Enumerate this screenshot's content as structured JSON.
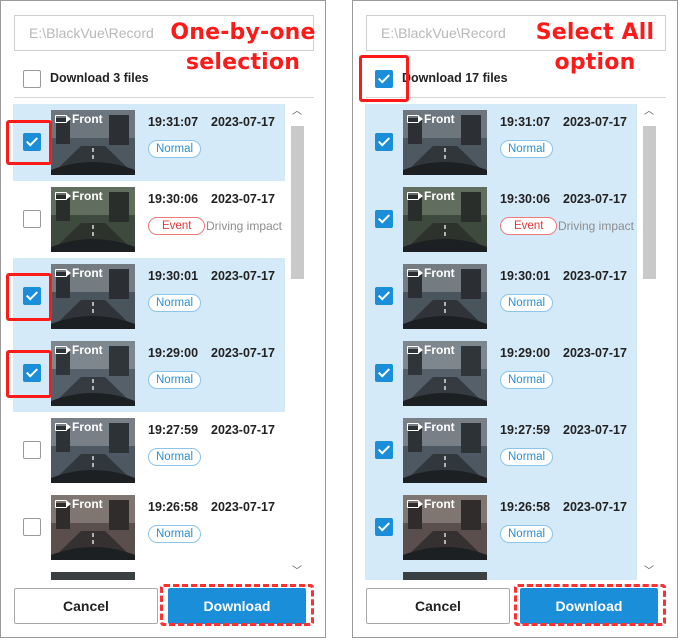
{
  "panels": [
    {
      "path_placeholder": "E:\\BlackVue\\Record",
      "callout": [
        "One-by-one",
        "selection"
      ],
      "select_all_checked": false,
      "download_count_text": "Download 3 files",
      "rows": [
        {
          "camera": "Front",
          "time": "19:31:07",
          "date": "2023-07-17",
          "badge": "Normal",
          "badge_type": "normal",
          "description": "",
          "checked": true
        },
        {
          "camera": "Front",
          "time": "19:30:06",
          "date": "2023-07-17",
          "badge": "Event",
          "badge_type": "event",
          "description": "Driving impact",
          "checked": false
        },
        {
          "camera": "Front",
          "time": "19:30:01",
          "date": "2023-07-17",
          "badge": "Normal",
          "badge_type": "normal",
          "description": "",
          "checked": true
        },
        {
          "camera": "Front",
          "time": "19:29:00",
          "date": "2023-07-17",
          "badge": "Normal",
          "badge_type": "normal",
          "description": "",
          "checked": true
        },
        {
          "camera": "Front",
          "time": "19:27:59",
          "date": "2023-07-17",
          "badge": "Normal",
          "badge_type": "normal",
          "description": "",
          "checked": false
        },
        {
          "camera": "Front",
          "time": "19:26:58",
          "date": "2023-07-17",
          "badge": "Normal",
          "badge_type": "normal",
          "description": "",
          "checked": false
        }
      ],
      "cancel_label": "Cancel",
      "download_label": "Download"
    },
    {
      "path_placeholder": "E:\\BlackVue\\Record",
      "callout": [
        "Select All",
        "option"
      ],
      "select_all_checked": true,
      "download_count_text": "Download 17 files",
      "rows": [
        {
          "camera": "Front",
          "time": "19:31:07",
          "date": "2023-07-17",
          "badge": "Normal",
          "badge_type": "normal",
          "description": "",
          "checked": true
        },
        {
          "camera": "Front",
          "time": "19:30:06",
          "date": "2023-07-17",
          "badge": "Event",
          "badge_type": "event",
          "description": "Driving impact",
          "checked": true
        },
        {
          "camera": "Front",
          "time": "19:30:01",
          "date": "2023-07-17",
          "badge": "Normal",
          "badge_type": "normal",
          "description": "",
          "checked": true
        },
        {
          "camera": "Front",
          "time": "19:29:00",
          "date": "2023-07-17",
          "badge": "Normal",
          "badge_type": "normal",
          "description": "",
          "checked": true
        },
        {
          "camera": "Front",
          "time": "19:27:59",
          "date": "2023-07-17",
          "badge": "Normal",
          "badge_type": "normal",
          "description": "",
          "checked": true
        },
        {
          "camera": "Front",
          "time": "19:26:58",
          "date": "2023-07-17",
          "badge": "Normal",
          "badge_type": "normal",
          "description": "",
          "checked": true
        }
      ],
      "cancel_label": "Cancel",
      "download_label": "Download"
    }
  ],
  "colors": {
    "accent": "#1a8ed8",
    "selected_row": "#d5eaf8",
    "callout": "#ff1a1a",
    "event": "#e23a3a",
    "normal": "#2a8ed0"
  },
  "icons": {
    "camera": "video-camera-icon",
    "scroll_up": "chevron-up-icon",
    "scroll_down": "chevron-down-icon",
    "checkbox": "checkbox-icon"
  }
}
